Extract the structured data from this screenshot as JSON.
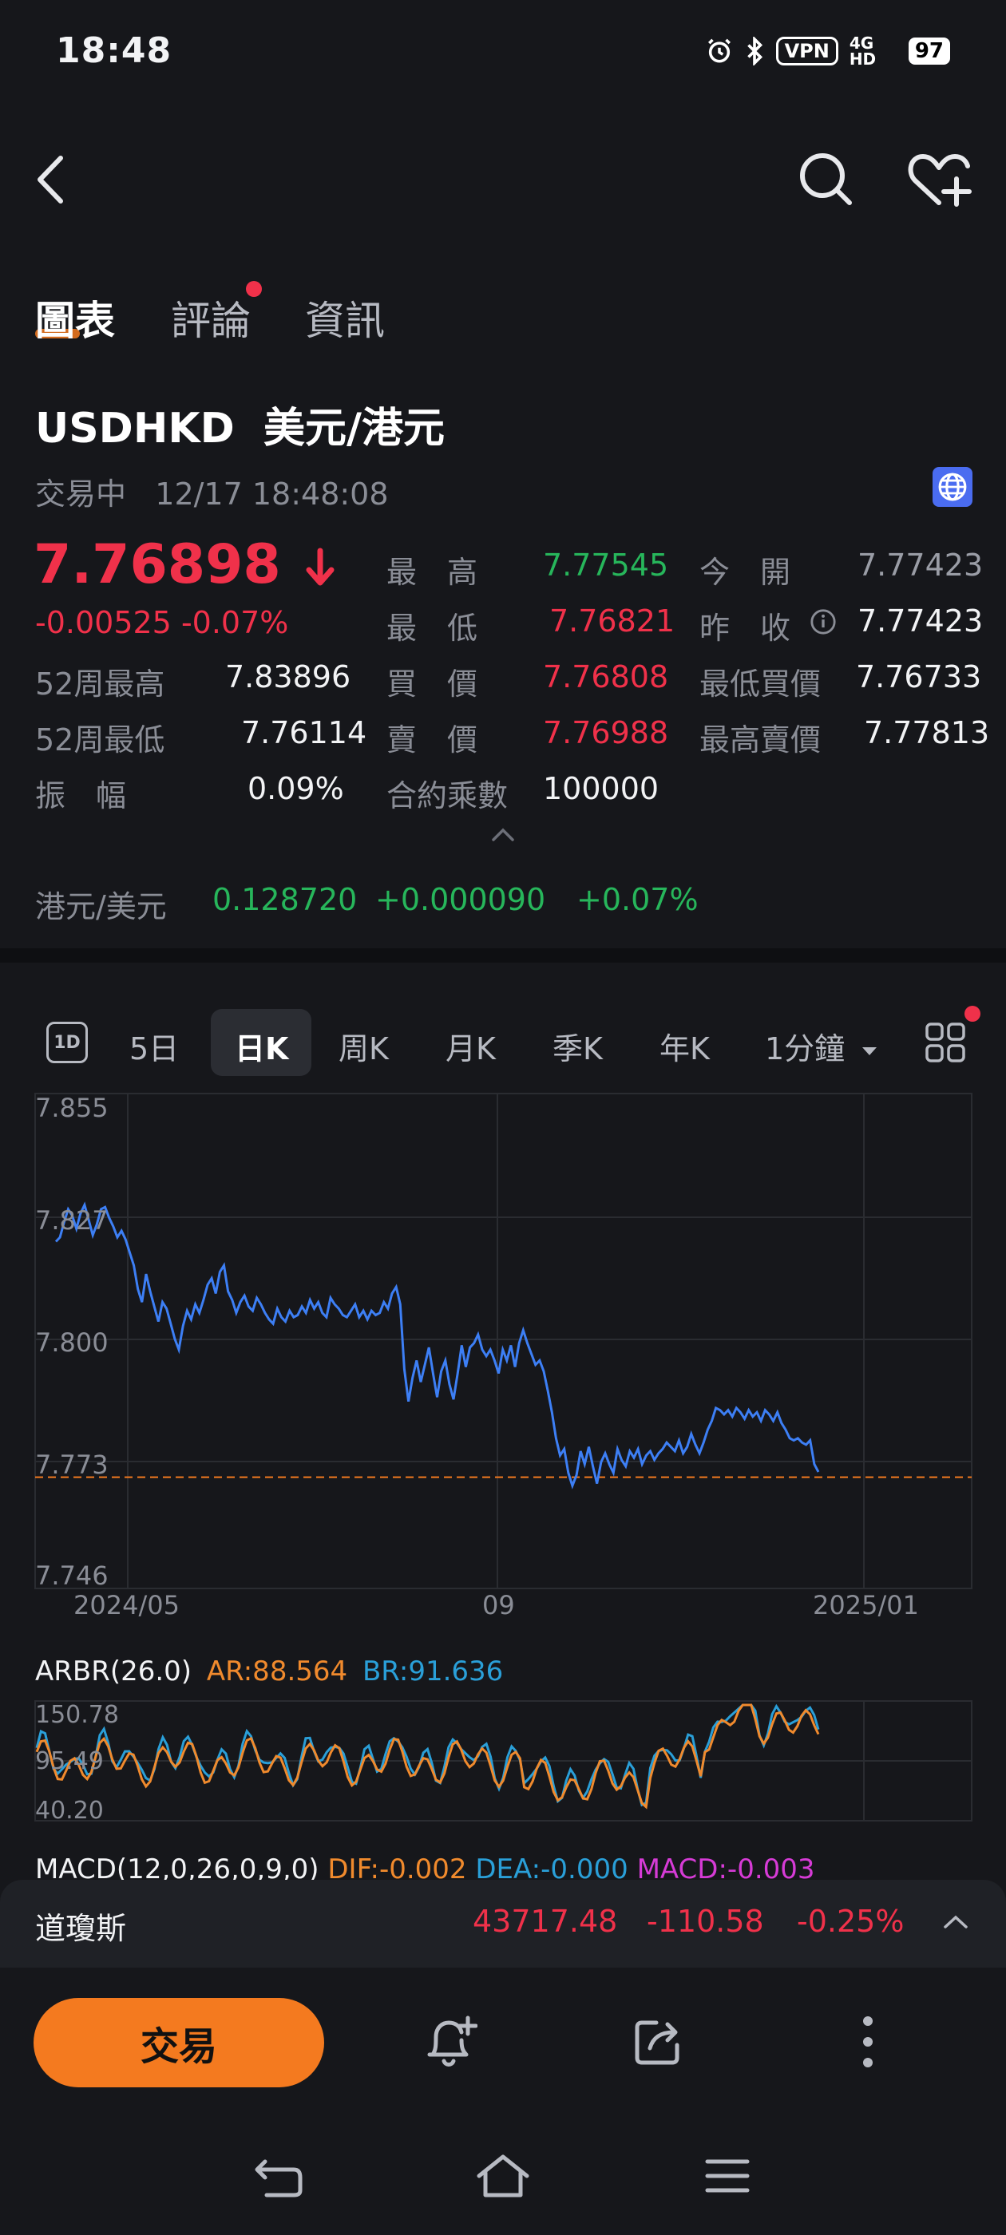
{
  "status_bar": {
    "time": "18:48",
    "vpn": "VPN",
    "network": "4G HD",
    "battery": "97"
  },
  "tabs": [
    {
      "label": "圖表",
      "active": true
    },
    {
      "label": "評論",
      "active": false,
      "badge_dot": true
    },
    {
      "label": "資訊",
      "active": false
    }
  ],
  "symbol": {
    "code": "USDHKD",
    "name": "美元/港元",
    "trade_status": "交易中",
    "timestamp": "12/17 18:48:08"
  },
  "quote": {
    "price": "7.76898",
    "change": "-0.00525",
    "change_pct": "-0.07%"
  },
  "stats": {
    "high_label": "最　高",
    "high": "7.77545",
    "open_label": "今　開",
    "open": "7.77423",
    "low_label": "最　低",
    "low": "7.76821",
    "prev_close_label": "昨　收",
    "prev_close": "7.77423",
    "w52_high_label": "52周最高",
    "w52_high": "7.83896",
    "bid_label": "買　價",
    "bid": "7.76808",
    "min_bid_label": "最低買價",
    "min_bid": "7.76733",
    "w52_low_label": "52周最低",
    "w52_low": "7.76114",
    "ask_label": "賣　價",
    "ask": "7.76988",
    "max_ask_label": "最高賣價",
    "max_ask": "7.77813",
    "amplitude_label": "振　幅",
    "amplitude": "0.09%",
    "multiplier_label": "合約乘數",
    "multiplier": "100000"
  },
  "cross_rate": {
    "label": "港元/美元",
    "value": "0.128720",
    "change": "+0.000090",
    "change_pct": "+0.07%"
  },
  "periods": {
    "intraday_icon": "1D",
    "items": [
      "5日",
      "日K",
      "周K",
      "月K",
      "季K",
      "年K"
    ],
    "active": "日K",
    "minute_label": "1分鐘"
  },
  "chart_data": [
    {
      "type": "line",
      "series_color": "#3d7ff5",
      "reference_line": 7.76898,
      "reference_color": "#f47a1f",
      "y_ticks": [
        "7.855",
        "7.827",
        "7.800",
        "7.773",
        "7.746"
      ],
      "ylim": [
        7.746,
        7.855
      ],
      "x_ticks": [
        "2024/05",
        "09",
        "2025/01"
      ],
      "values": [
        7.8235,
        7.8245,
        7.828,
        7.831,
        7.8295,
        7.8265,
        7.83,
        7.832,
        7.8285,
        7.825,
        7.8275,
        7.831,
        7.8315,
        7.829,
        7.827,
        7.8245,
        7.826,
        7.824,
        7.821,
        7.818,
        7.8125,
        7.8095,
        7.816,
        7.812,
        7.8085,
        7.805,
        7.8095,
        7.808,
        7.8045,
        7.801,
        7.7985,
        7.804,
        7.8075,
        7.8055,
        7.809,
        7.807,
        7.81,
        7.8135,
        7.815,
        7.8115,
        7.8165,
        7.818,
        7.812,
        7.81,
        7.807,
        7.8095,
        7.811,
        7.8085,
        7.8075,
        7.8105,
        7.809,
        7.807,
        7.8055,
        7.8045,
        7.808,
        7.806,
        7.805,
        7.8075,
        7.806,
        7.8065,
        7.8085,
        7.807,
        7.81,
        7.808,
        7.8095,
        7.807,
        7.806,
        7.8105,
        7.809,
        7.808,
        7.8065,
        7.806,
        7.8075,
        7.809,
        7.806,
        7.8075,
        7.8055,
        7.8075,
        7.8065,
        7.807,
        7.8095,
        7.808,
        7.8115,
        7.813,
        7.809,
        7.794,
        7.7865,
        7.792,
        7.796,
        7.791,
        7.795,
        7.799,
        7.793,
        7.7875,
        7.7935,
        7.796,
        7.7905,
        7.787,
        7.793,
        7.7995,
        7.7945,
        7.799,
        7.8,
        7.802,
        7.7985,
        7.797,
        7.7985,
        7.796,
        7.793,
        7.7985,
        7.796,
        7.7995,
        7.7945,
        7.8,
        7.803,
        7.8,
        7.7975,
        7.795,
        7.796,
        7.7935,
        7.789,
        7.784,
        7.778,
        7.774,
        7.7755,
        7.77,
        7.767,
        7.7695,
        7.775,
        7.772,
        7.776,
        7.7715,
        7.7675,
        7.7725,
        7.7745,
        7.772,
        7.77,
        7.7755,
        7.773,
        7.7715,
        7.775,
        7.7735,
        7.7755,
        7.772,
        7.774,
        7.775,
        7.773,
        7.7745,
        7.7755,
        7.777,
        7.776,
        7.775,
        7.7775,
        7.7745,
        7.776,
        7.779,
        7.7765,
        7.7745,
        7.777,
        7.78,
        7.782,
        7.785,
        7.7845,
        7.7835,
        7.7845,
        7.783,
        7.785,
        7.784,
        7.7825,
        7.7845,
        7.783,
        7.784,
        7.782,
        7.7845,
        7.7835,
        7.782,
        7.784,
        7.7815,
        7.78,
        7.778,
        7.7775,
        7.778,
        7.777,
        7.7765,
        7.7775,
        7.772,
        7.7702
      ]
    },
    {
      "type": "line",
      "title": "ARBR(26.0)",
      "series": [
        {
          "name": "AR",
          "label": "AR:88.564",
          "color": "#f08a2d"
        },
        {
          "name": "BR",
          "label": "BR:91.636",
          "color": "#2a9fd8"
        }
      ],
      "y_ticks": [
        "150.78",
        "95.49",
        "40.20"
      ],
      "ylim": [
        40.2,
        150.78
      ]
    }
  ],
  "macd_label": {
    "title": "MACD(12,0,26,0,9,0)",
    "dif": "DIF:-0.002",
    "dea": "DEA:-0.000",
    "macd": "MACD:-0.003"
  },
  "index_bar": {
    "name": "道瓊斯",
    "value": "43717.48",
    "change": "-110.58",
    "change_pct": "-0.25%"
  },
  "actions": {
    "trade": "交易"
  }
}
